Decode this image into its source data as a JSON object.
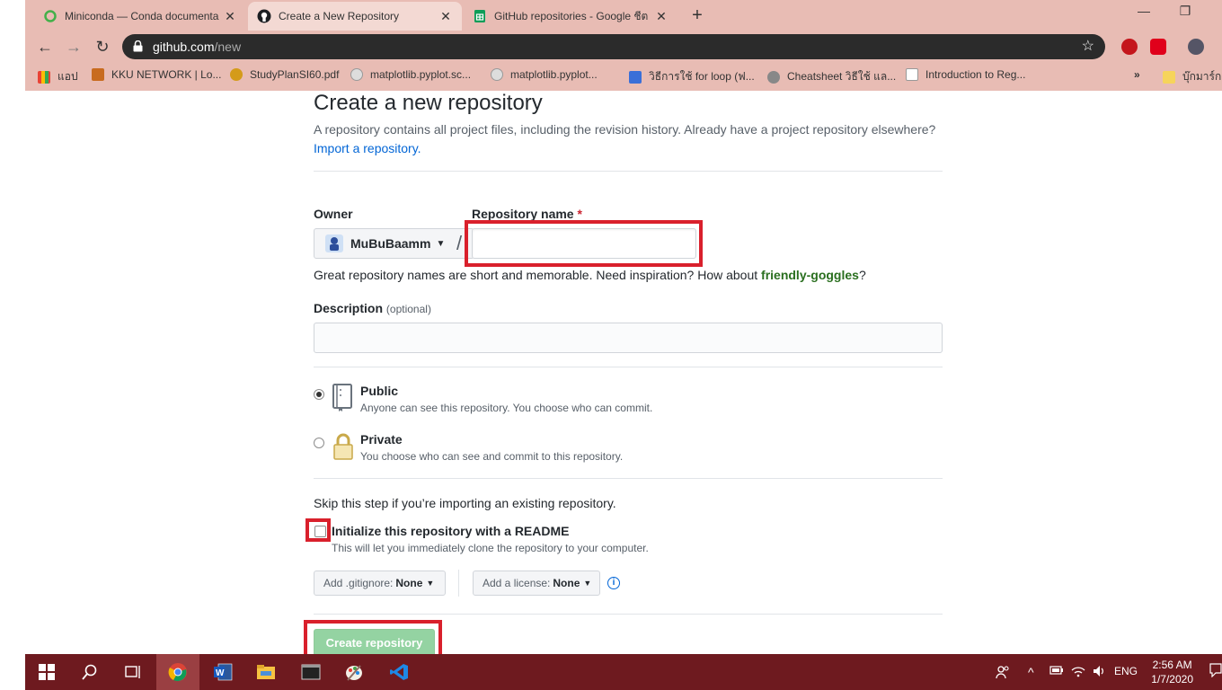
{
  "browser": {
    "tabs": [
      {
        "title": "Miniconda — Conda documenta",
        "icon": "conda-icon"
      },
      {
        "title": "Create a New Repository",
        "icon": "github-icon"
      },
      {
        "title": "GitHub repositories - Google ชีต",
        "icon": "sheets-icon"
      }
    ],
    "url_host": "github.com",
    "url_path": "/new",
    "bookmarks": [
      "แอป",
      "KKU NETWORK | Lo...",
      "StudyPlanSI60.pdf",
      "matplotlib.pyplot.sc...",
      "matplotlib.pyplot...",
      "วิธีการใช้ for loop (ฟ...",
      "Cheatsheet วิธีใช้ แล...",
      "Introduction to Reg...",
      "บุ๊กมาร์กอื่"
    ]
  },
  "form": {
    "title": "Create a new repository",
    "subtitle": "A repository contains all project files, including the revision history. Already have a project repository elsewhere?",
    "import_link": "Import a repository.",
    "owner_label": "Owner",
    "owner_value": "MuBuBaamm",
    "repo_label": "Repository name",
    "required_mark": "*",
    "repo_value": "",
    "hint_prefix": "Great repository names are short and memorable. Need inspiration? How about ",
    "hint_suggestion": "friendly-goggles",
    "hint_suffix": "?",
    "description_label": "Description",
    "description_optional": "(optional)",
    "description_value": "",
    "visibility": [
      {
        "title": "Public",
        "desc": "Anyone can see this repository. You choose who can commit.",
        "checked": true
      },
      {
        "title": "Private",
        "desc": "You choose who can see and commit to this repository.",
        "checked": false
      }
    ],
    "skip_text": "Skip this step if you’re importing an existing repository.",
    "readme_title": "Initialize this repository with a README",
    "readme_desc": "This will let you immediately clone the repository to your computer.",
    "gitignore_label": "Add .gitignore:",
    "gitignore_value": "None",
    "license_label": "Add a license:",
    "license_value": "None",
    "create_button": "Create repository"
  },
  "taskbar": {
    "lang": "ENG",
    "time": "2:56 AM",
    "date": "1/7/2020"
  },
  "colors": {
    "highlight_red": "#d9202c",
    "create_green": "#94d3a2",
    "chrome_tint": "#e8bcb4",
    "taskbar": "#6e1a1f"
  }
}
